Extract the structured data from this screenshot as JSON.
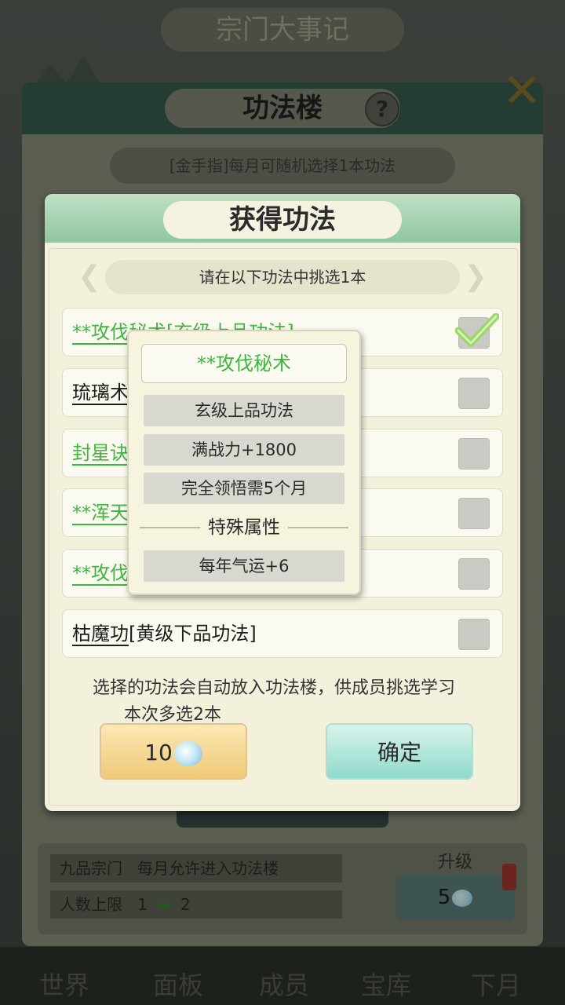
{
  "background": {
    "top_banner": "宗门大事记",
    "panel_title": "功法楼",
    "help_icon": "?",
    "notice": "[金手指]每月可随机选择1本功法",
    "rows": [
      {
        "label": "九品宗门",
        "value": "每月允许进入功法楼"
      },
      {
        "label": "人数上限",
        "from": "1",
        "to": "2"
      }
    ],
    "upgrade_label": "升级",
    "upgrade_cost": "5",
    "nav": [
      "世界",
      "面板",
      "成员",
      "宝库",
      "下月"
    ]
  },
  "dialog": {
    "title": "获得功法",
    "hint": "请在以下功法中挑选1本",
    "options": [
      {
        "name": "**攻伐秘术",
        "grade": "[玄级上品功法]",
        "color": "green",
        "checked": true
      },
      {
        "name": "琉璃术",
        "grade": "",
        "color": "dark",
        "checked": false
      },
      {
        "name": "封星诀",
        "grade": "",
        "color": "green",
        "checked": false
      },
      {
        "name": "**浑天",
        "grade": "",
        "color": "green",
        "checked": false
      },
      {
        "name": "**攻伐",
        "grade": "",
        "color": "green",
        "checked": false
      },
      {
        "name": "枯魔功",
        "grade": "[黄级下品功法]",
        "color": "dark",
        "checked": false
      }
    ],
    "info_line1": "选择的功法会自动放入功法楼，供成员挑选学习",
    "info_line2": "本次多选2本",
    "cost_button": "10",
    "confirm_button": "确定"
  },
  "tooltip": {
    "title": "**攻伐秘术",
    "grade": "玄级上品功法",
    "power": "满战力+1800",
    "comprehension": "完全领悟需5个月",
    "section": "特殊属性",
    "special": "每年气运+6"
  },
  "colors": {
    "green_text": "#3cb83c",
    "header_green": "#8fc6a0",
    "dialog_bg": "#f3f1dc",
    "gold_button": "#f0c978",
    "teal_button": "#8fdacc"
  }
}
